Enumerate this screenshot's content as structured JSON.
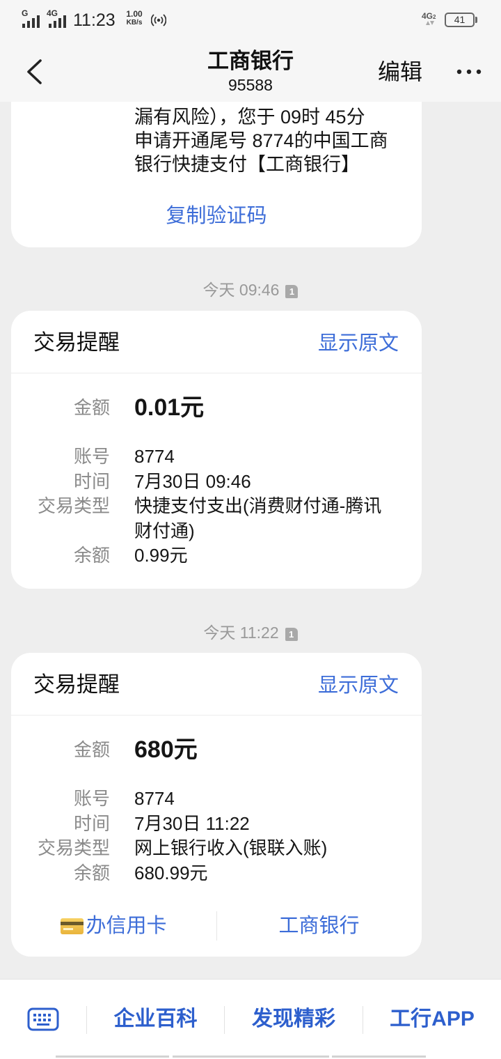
{
  "status_bar": {
    "sim1_network": "G",
    "sim2_network": "4G",
    "time": "11:23",
    "net_speed_value": "1.00",
    "net_speed_unit": "KB/s",
    "right_network": "4G",
    "right_network_slot": "2",
    "battery_level": "41",
    "signal_icon": "signal-icon",
    "hotspot_icon": "hotspot-icon",
    "battery_icon": "battery-icon"
  },
  "header": {
    "title": "工商银行",
    "phone_number": "95588",
    "edit_label": "编辑",
    "back_icon": "back-chevron-icon",
    "more_icon": "more-icon"
  },
  "conversation": {
    "verification_message": {
      "lines": [
        "漏有风险），您于 09时 45分",
        "申请开通尾号 8774的中国工商",
        "银行快捷支付【工商银行】"
      ],
      "copy_code_label": "复制验证码"
    },
    "transactions": [
      {
        "timestamp": "今天 09:46",
        "sim_slot": "1",
        "title": "交易提醒",
        "show_original_label": "显示原文",
        "amount_label": "金额",
        "amount": "0.01元",
        "details": [
          {
            "label": "账号",
            "value": "8774"
          },
          {
            "label": "时间",
            "value": "7月30日 09:46"
          },
          {
            "label": "交易类型",
            "value": "快捷支付支出(消费财付通-腾讯财付通)"
          },
          {
            "label": "余额",
            "value": "0.99元"
          }
        ]
      },
      {
        "timestamp": "今天 11:22",
        "sim_slot": "1",
        "title": "交易提醒",
        "show_original_label": "显示原文",
        "amount_label": "金额",
        "amount": "680元",
        "details": [
          {
            "label": "账号",
            "value": "8774"
          },
          {
            "label": "时间",
            "value": "7月30日 11:22"
          },
          {
            "label": "交易类型",
            "value": "网上银行收入(银联入账)"
          },
          {
            "label": "余额",
            "value": "680.99元"
          }
        ],
        "actions": [
          {
            "label": "办信用卡",
            "icon": "credit-card-icon"
          },
          {
            "label": "工商银行"
          }
        ]
      }
    ]
  },
  "bottom_menu": {
    "keyboard_icon": "keyboard-icon",
    "items": [
      "企业百科",
      "发现精彩",
      "工行APP"
    ]
  },
  "colors": {
    "background": "#eeeeee",
    "card_background": "#ffffff",
    "accent_blue": "#3d6dd8",
    "menu_blue": "#2d5fcd",
    "label_gray": "#8a8a8a"
  }
}
